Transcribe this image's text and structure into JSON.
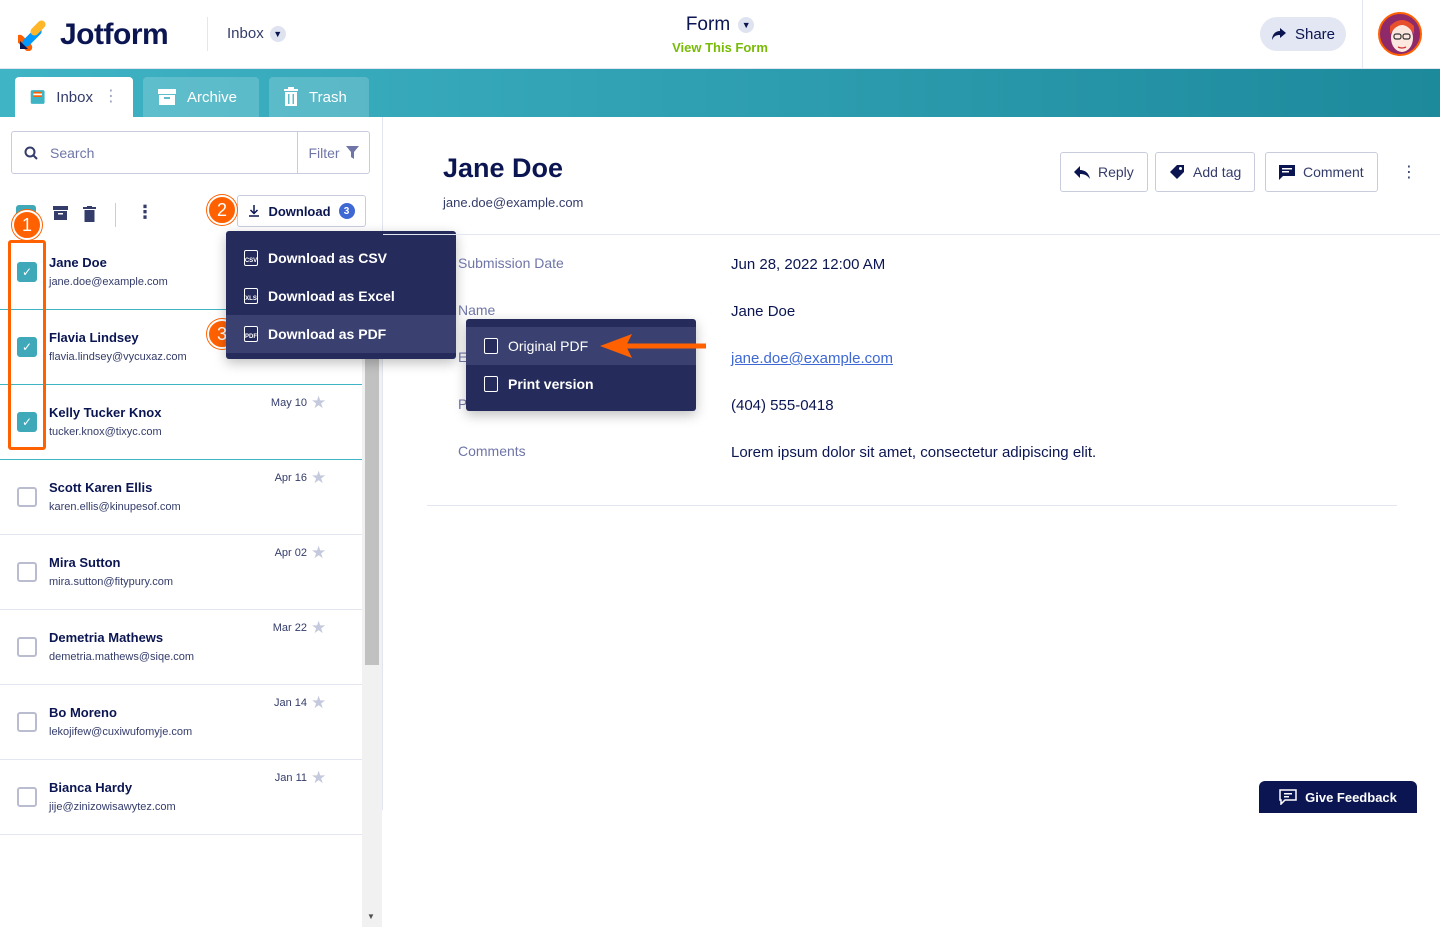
{
  "app": {
    "brand": "Jotform",
    "inbox_selector": "Inbox",
    "form_title": "Form",
    "view_form_link": "View This Form",
    "share_label": "Share"
  },
  "tabs": [
    {
      "label": "Inbox",
      "active": true
    },
    {
      "label": "Archive",
      "active": false
    },
    {
      "label": "Trash",
      "active": false
    }
  ],
  "search": {
    "placeholder": "Search",
    "filter_label": "Filter"
  },
  "toolbar": {
    "download_label": "Download",
    "download_count": "3"
  },
  "download_menu": [
    {
      "label": "Download as CSV",
      "icon": "csv-file-icon",
      "ext": "CSV"
    },
    {
      "label": "Download as Excel",
      "icon": "xls-file-icon",
      "ext": "XLS"
    },
    {
      "label": "Download as PDF",
      "icon": "pdf-file-icon",
      "ext": "PDF"
    }
  ],
  "pdf_submenu": [
    {
      "label": "Original PDF",
      "icon": "pdf-file-icon"
    },
    {
      "label": "Print version",
      "icon": "pdf-file-icon"
    }
  ],
  "steps": [
    "1",
    "2",
    "3"
  ],
  "submissions": [
    {
      "name": "Jane Doe",
      "email": "jane.doe@example.com",
      "date": "",
      "checked": true
    },
    {
      "name": "Flavia Lindsey",
      "email": "flavia.lindsey@vycuxaz.com",
      "date": "",
      "checked": true
    },
    {
      "name": "Kelly Tucker Knox",
      "email": "tucker.knox@tixyc.com",
      "date": "May 10",
      "checked": true
    },
    {
      "name": "Scott Karen Ellis",
      "email": "karen.ellis@kinupesof.com",
      "date": "Apr 16",
      "checked": false
    },
    {
      "name": "Mira Sutton",
      "email": "mira.sutton@fitypury.com",
      "date": "Apr 02",
      "checked": false
    },
    {
      "name": "Demetria Mathews",
      "email": "demetria.mathews@siqe.com",
      "date": "Mar 22",
      "checked": false
    },
    {
      "name": "Bo Moreno",
      "email": "lekojifew@cuxiwufomyje.com",
      "date": "Jan 14",
      "checked": false
    },
    {
      "name": "Bianca Hardy",
      "email": "jije@zinizowisawytez.com",
      "date": "Jan 11",
      "checked": false
    }
  ],
  "detail": {
    "name": "Jane Doe",
    "email": "jane.doe@example.com",
    "actions": {
      "reply": "Reply",
      "add_tag": "Add tag",
      "comment": "Comment"
    },
    "fields": [
      {
        "label": "Submission Date",
        "value": "Jun 28, 2022 12:00 AM"
      },
      {
        "label": "Name",
        "value": "Jane Doe"
      },
      {
        "label": "E",
        "value": "jane.doe@example.com"
      },
      {
        "label": "P",
        "value": "(404) 555-0418"
      },
      {
        "label": "Comments",
        "value": "Lorem ipsum dolor sit amet, consectetur adipiscing elit."
      }
    ]
  },
  "feedback_label": "Give Feedback",
  "colors": {
    "brand_navy": "#0a1551",
    "accent_orange": "#ff6100",
    "teal": "#3fb4c5",
    "menu_bg": "#252b5b",
    "link_blue": "#3e68d3"
  }
}
